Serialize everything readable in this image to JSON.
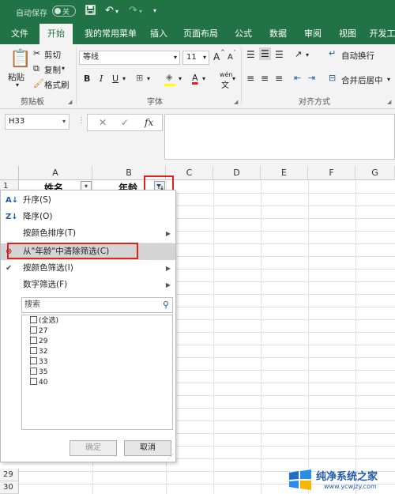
{
  "titlebar": {
    "autosave_label": "自动保存",
    "autosave_state": "关",
    "save_icon": "save-icon",
    "undo_icon": "undo-icon",
    "redo_icon": "redo-icon"
  },
  "tabs": [
    "文件",
    "开始",
    "我的常用菜单",
    "插入",
    "页面布局",
    "公式",
    "数据",
    "审阅",
    "视图",
    "开发工"
  ],
  "active_tab": "开始",
  "ribbon": {
    "paste": "粘贴",
    "cut": "剪切",
    "copy": "复制",
    "format_painter": "格式刷",
    "clipboard_group": "剪贴板",
    "font_name": "等线",
    "font_size": "11",
    "font_group": "字体",
    "bold": "B",
    "italic": "I",
    "underline": "U",
    "font_color_letter": "A",
    "phonetic": "wén",
    "grow_font": "A",
    "shrink_font": "A",
    "wrap_text": "自动换行",
    "merge_center": "合并后居中",
    "alignment_group": "对齐方式"
  },
  "formula_bar": {
    "name_box": "H33",
    "fx": "fx",
    "cancel": "✕",
    "enter": "✓"
  },
  "columns": [
    "A",
    "B",
    "C",
    "D",
    "E",
    "F",
    "G"
  ],
  "rows_visible": [
    "1",
    "29",
    "30"
  ],
  "cells": {
    "A1": "姓名",
    "B1": "年龄"
  },
  "filter_menu": {
    "sort_asc": "升序(S)",
    "sort_desc": "降序(O)",
    "sort_by_color": "按颜色排序(T)",
    "clear_filter": "从\"年龄\"中清除筛选(C)",
    "filter_by_color": "按颜色筛选(I)",
    "number_filter": "数字筛选(F)",
    "search_placeholder": "搜索",
    "list": [
      "(全选)",
      "27",
      "29",
      "32",
      "33",
      "35",
      "40"
    ],
    "ok": "确定",
    "cancel": "取消"
  },
  "watermark": {
    "title": "纯净系统之家",
    "url": "www.ycwjzy.com"
  },
  "colors": {
    "brand_green": "#217346",
    "highlight_red": "#e0211d"
  }
}
